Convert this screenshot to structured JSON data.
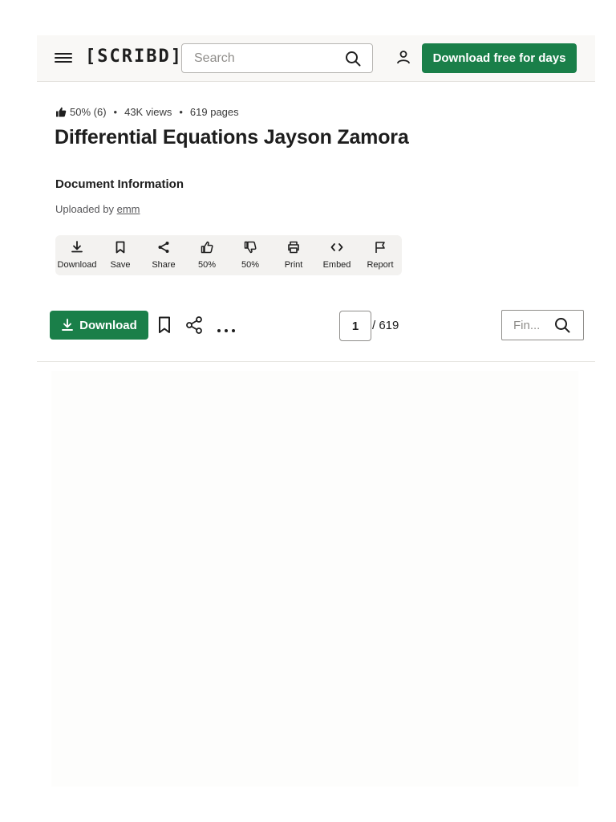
{
  "header": {
    "logo": "[SCRIBD]",
    "search_placeholder": "Search",
    "cta_label": "Download free for days"
  },
  "doc": {
    "rating": "50% (6)",
    "views": "43K views",
    "pages": "619 pages",
    "title": "Differential Equations Jayson Zamora",
    "info_heading": "Document Information",
    "uploaded_prefix": "Uploaded by",
    "uploader": "emm"
  },
  "actions": [
    {
      "label": "Download",
      "icon": "download-icon"
    },
    {
      "label": "Save",
      "icon": "bookmark-icon"
    },
    {
      "label": "Share",
      "icon": "share-icon"
    },
    {
      "label": "50%",
      "icon": "thumbs-up-icon"
    },
    {
      "label": "50%",
      "icon": "thumbs-down-icon"
    },
    {
      "label": "Print",
      "icon": "print-icon"
    },
    {
      "label": "Embed",
      "icon": "embed-icon"
    },
    {
      "label": "Report",
      "icon": "flag-icon"
    }
  ],
  "toolbar": {
    "download_label": "Download",
    "current_page": "1",
    "total_pages": "/ 619",
    "find_placeholder": "Fin..."
  },
  "colors": {
    "accent": "#1a7f49",
    "header_bg": "#f9f8f6"
  }
}
